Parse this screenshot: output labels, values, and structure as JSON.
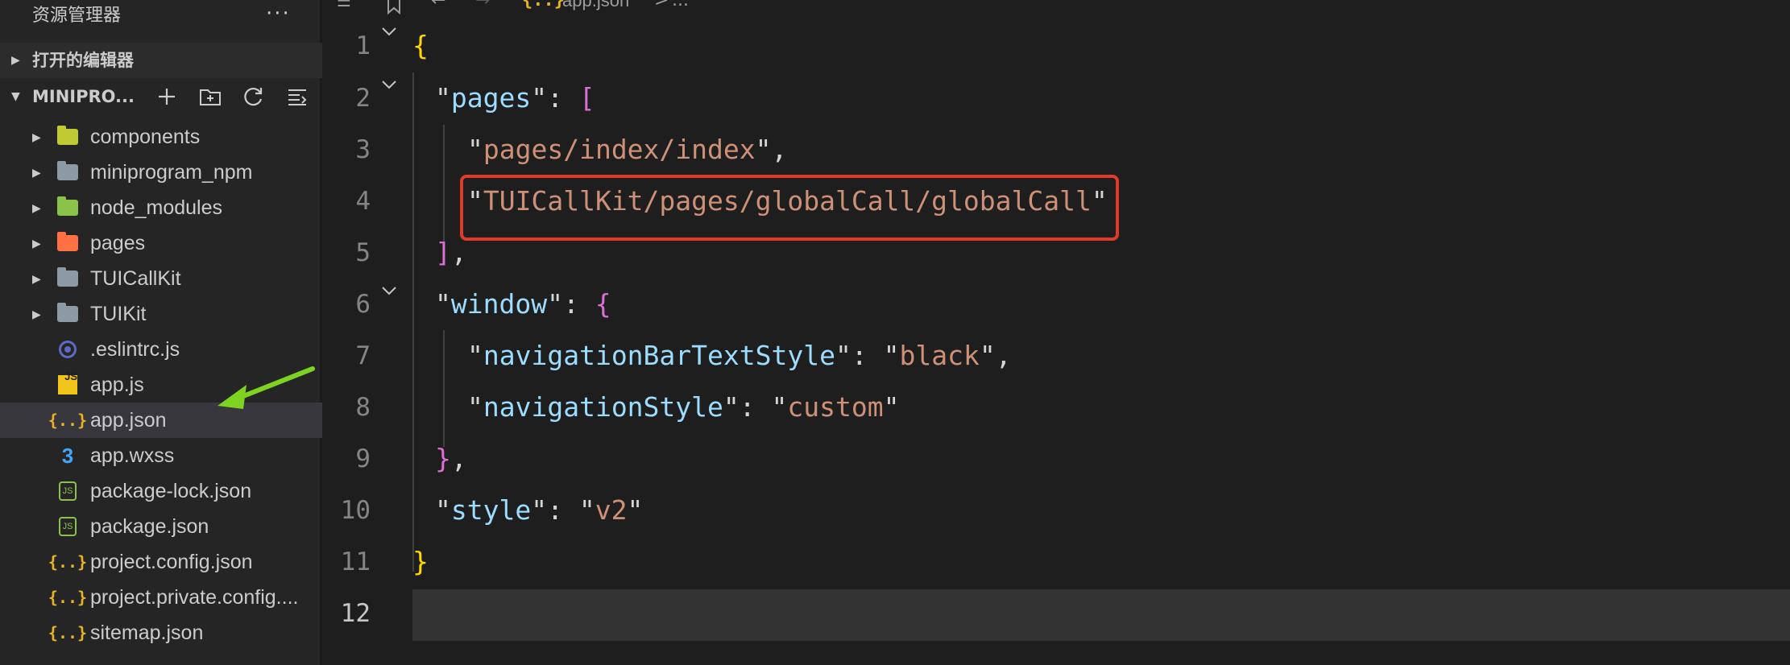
{
  "sidebar": {
    "title": "资源管理器",
    "more_icon": "more-icon",
    "sections": {
      "open_editors": "打开的编辑器",
      "project": "MINIPRO..."
    },
    "project_actions": [
      "new-file-icon",
      "new-folder-icon",
      "refresh-icon",
      "collapse-icon"
    ],
    "files": [
      {
        "name": "components",
        "type": "folder",
        "icon": "components-folder-icon"
      },
      {
        "name": "miniprogram_npm",
        "type": "folder",
        "icon": "folder-icon"
      },
      {
        "name": "node_modules",
        "type": "folder",
        "icon": "node-folder-icon"
      },
      {
        "name": "pages",
        "type": "folder",
        "icon": "pages-folder-icon"
      },
      {
        "name": "TUICallKit",
        "type": "folder",
        "icon": "folder-icon"
      },
      {
        "name": "TUIKit",
        "type": "folder",
        "icon": "folder-icon"
      },
      {
        "name": ".eslintrc.js",
        "type": "file",
        "icon": "eslint-icon"
      },
      {
        "name": "app.js",
        "type": "file",
        "icon": "js-icon"
      },
      {
        "name": "app.json",
        "type": "file",
        "icon": "json-icon",
        "selected": true
      },
      {
        "name": "app.wxss",
        "type": "file",
        "icon": "css-icon"
      },
      {
        "name": "package-lock.json",
        "type": "file",
        "icon": "nodejs-icon"
      },
      {
        "name": "package.json",
        "type": "file",
        "icon": "nodejs-icon"
      },
      {
        "name": "project.config.json",
        "type": "file",
        "icon": "json-icon"
      },
      {
        "name": "project.private.config....",
        "type": "file",
        "icon": "json-icon"
      },
      {
        "name": "sitemap.json",
        "type": "file",
        "icon": "json-icon"
      }
    ]
  },
  "breadcrumb": {
    "file": "app.json",
    "separator": ">",
    "ellipsis": "..."
  },
  "editor": {
    "active_line": 12,
    "highlight_line": 4,
    "lines": [
      {
        "n": "1",
        "text": "{"
      },
      {
        "n": "2",
        "text": "\"pages\": ["
      },
      {
        "n": "3",
        "text": "\"pages/index/index\","
      },
      {
        "n": "4",
        "text": "\"TUICallKit/pages/globalCall/globalCall\""
      },
      {
        "n": "5",
        "text": "],"
      },
      {
        "n": "6",
        "text": "\"window\": {"
      },
      {
        "n": "7",
        "text": "\"navigationBarTextStyle\": \"black\","
      },
      {
        "n": "8",
        "text": "\"navigationStyle\": \"custom\""
      },
      {
        "n": "9",
        "text": "},"
      },
      {
        "n": "10",
        "text": "\"style\": \"v2\""
      },
      {
        "n": "11",
        "text": "}"
      },
      {
        "n": "12",
        "text": ""
      }
    ]
  },
  "colors": {
    "annotation_arrow": "#7ed321",
    "highlight_box": "#e03a2a",
    "key": "#9cdcfe",
    "string": "#ce9178"
  }
}
